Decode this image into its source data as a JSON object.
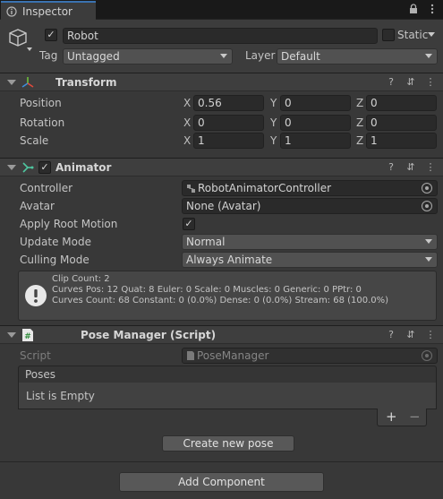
{
  "tab": {
    "title": "Inspector",
    "icons": [
      "info-icon",
      "lock-icon",
      "more-menu-icon"
    ]
  },
  "header": {
    "object_name": "Robot",
    "active": true,
    "static_label": "Static",
    "tag_label": "Tag",
    "tag_value": "Untagged",
    "layer_label": "Layer",
    "layer_value": "Default"
  },
  "transform": {
    "title": "Transform",
    "position_label": "Position",
    "rotation_label": "Rotation",
    "scale_label": "Scale",
    "axis_x": "X",
    "axis_y": "Y",
    "axis_z": "Z",
    "position": {
      "x": "0.56",
      "y": "0",
      "z": "0"
    },
    "rotation": {
      "x": "0",
      "y": "0",
      "z": "0"
    },
    "scale": {
      "x": "1",
      "y": "1",
      "z": "1"
    }
  },
  "animator": {
    "title": "Animator",
    "enabled": true,
    "controller_label": "Controller",
    "controller_value": "RobotAnimatorController",
    "avatar_label": "Avatar",
    "avatar_value": "None (Avatar)",
    "apply_root_motion_label": "Apply Root Motion",
    "apply_root_motion": true,
    "update_mode_label": "Update Mode",
    "update_mode_value": "Normal",
    "culling_mode_label": "Culling Mode",
    "culling_mode_value": "Always Animate",
    "info_line1": "Clip Count: 2",
    "info_line2": "Curves Pos: 12 Quat: 8 Euler: 0 Scale: 0 Muscles: 0 Generic: 0 PPtr: 0",
    "info_line3": "Curves Count: 68 Constant: 0 (0.0%) Dense: 0 (0.0%) Stream: 68 (100.0%)"
  },
  "pose_manager": {
    "title": "Pose Manager (Script)",
    "script_label": "Script",
    "script_value": "PoseManager",
    "list_header": "Poses",
    "list_empty": "List is Empty",
    "add_symbol": "+",
    "remove_symbol": "−",
    "create_button": "Create new pose"
  },
  "add_component_button": "Add Component",
  "colors": {
    "accent": "#3a72b0",
    "panel": "#383838",
    "header": "#3e3e3e",
    "field": "#2a2a2a"
  }
}
